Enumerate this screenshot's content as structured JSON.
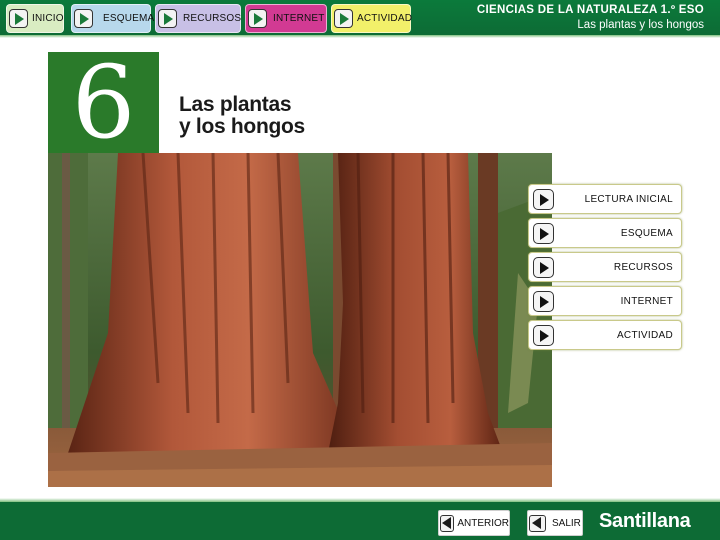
{
  "top_nav": {
    "items": [
      {
        "label": "INICIO"
      },
      {
        "label": "ESQUEMA"
      },
      {
        "label": "RECURSOS"
      },
      {
        "label": "INTERNET"
      },
      {
        "label": "ACTIVIDAD"
      }
    ]
  },
  "header": {
    "course": "CIENCIAS DE LA NATURALEZA 1.º ESO",
    "unit_subtitle": "Las plantas y los hongos"
  },
  "unit": {
    "number": "6",
    "title_line1": "Las plantas",
    "title_line2": "y los hongos"
  },
  "side_menu": {
    "items": [
      {
        "label": "LECTURA INICIAL"
      },
      {
        "label": "ESQUEMA"
      },
      {
        "label": "RECURSOS"
      },
      {
        "label": "INTERNET"
      },
      {
        "label": "ACTIVIDAD"
      }
    ]
  },
  "bottom_nav": {
    "previous_label": "ANTERIOR",
    "exit_label": "SALIR",
    "brand": "Santillana"
  },
  "colors": {
    "bar_green": "#0d6b35",
    "unit_green": "#2a7a2a",
    "inicio": "#d9ecc2",
    "esquema": "#b7d8ec",
    "recursos": "#c8c0e6",
    "internet": "#d23a93",
    "actividad": "#f2f06a"
  }
}
